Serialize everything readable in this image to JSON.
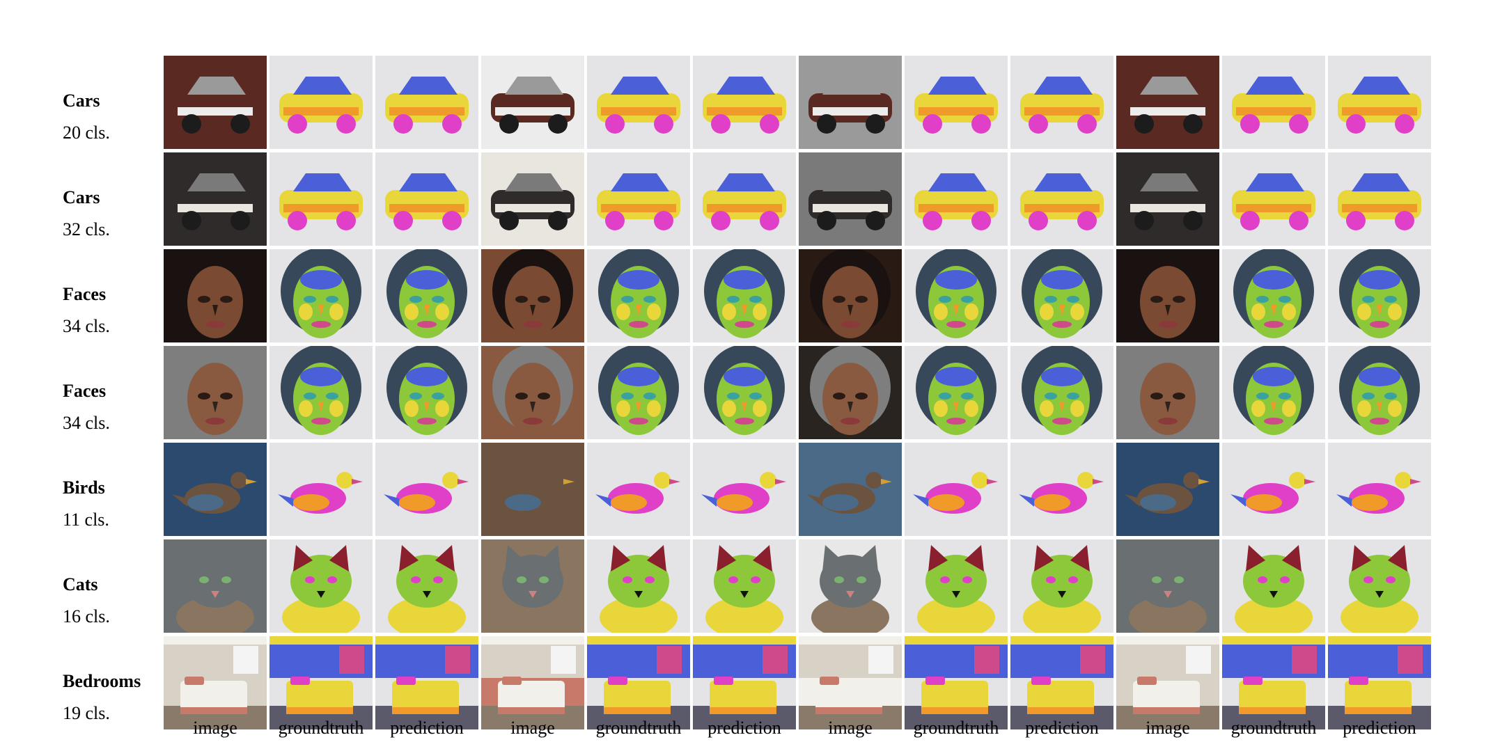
{
  "column_labels": [
    "image",
    "groundtruth",
    "prediction",
    "image",
    "groundtruth",
    "prediction",
    "image",
    "groundtruth",
    "prediction",
    "image",
    "groundtruth",
    "prediction"
  ],
  "rows": [
    {
      "name": "Cars",
      "classes": "20 cls.",
      "subjects": [
        "car",
        "car",
        "car",
        "car"
      ]
    },
    {
      "name": "Cars",
      "classes": "32 cls.",
      "subjects": [
        "car",
        "car",
        "car",
        "car"
      ]
    },
    {
      "name": "Faces",
      "classes": "34 cls.",
      "subjects": [
        "face",
        "face",
        "face",
        "face"
      ]
    },
    {
      "name": "Faces",
      "classes": "34 cls.",
      "subjects": [
        "face",
        "face",
        "face",
        "face"
      ]
    },
    {
      "name": "Birds",
      "classes": "11 cls.",
      "subjects": [
        "bird",
        "bird",
        "bird",
        "bird"
      ]
    },
    {
      "name": "Cats",
      "classes": "16 cls.",
      "subjects": [
        "cat",
        "cat",
        "cat",
        "cat"
      ]
    },
    {
      "name": "Bedrooms",
      "classes": "19 cls.",
      "subjects": [
        "bedroom",
        "bedroom",
        "bedroom",
        "bedroom"
      ]
    }
  ],
  "photo_palettes": [
    [
      "#5a2a22",
      "#ececec",
      "#9a9a9a"
    ],
    [
      "#2f2b2a",
      "#e8e6de",
      "#7a7a7a"
    ],
    [
      "#1a1210",
      "#7a4a32",
      "#2a1a14"
    ],
    [
      "#7e7e7e",
      "#8a5a40",
      "#2a2420"
    ],
    [
      "#2c4a6e",
      "#6b5340",
      "#4a6a88"
    ],
    [
      "#6a6f72",
      "#8a7660",
      "#e8e8e8"
    ],
    [
      "#d8d2c6",
      "#c87a6a",
      "#f2f0ea"
    ]
  ],
  "seg_palette": {
    "background": "#e4e4e6",
    "parts": [
      "#e8d63a",
      "#f09a2a",
      "#4a5fd8",
      "#e040c8",
      "#8cc83a",
      "#36485a",
      "#cf4a8a",
      "#3aa0a0"
    ]
  }
}
